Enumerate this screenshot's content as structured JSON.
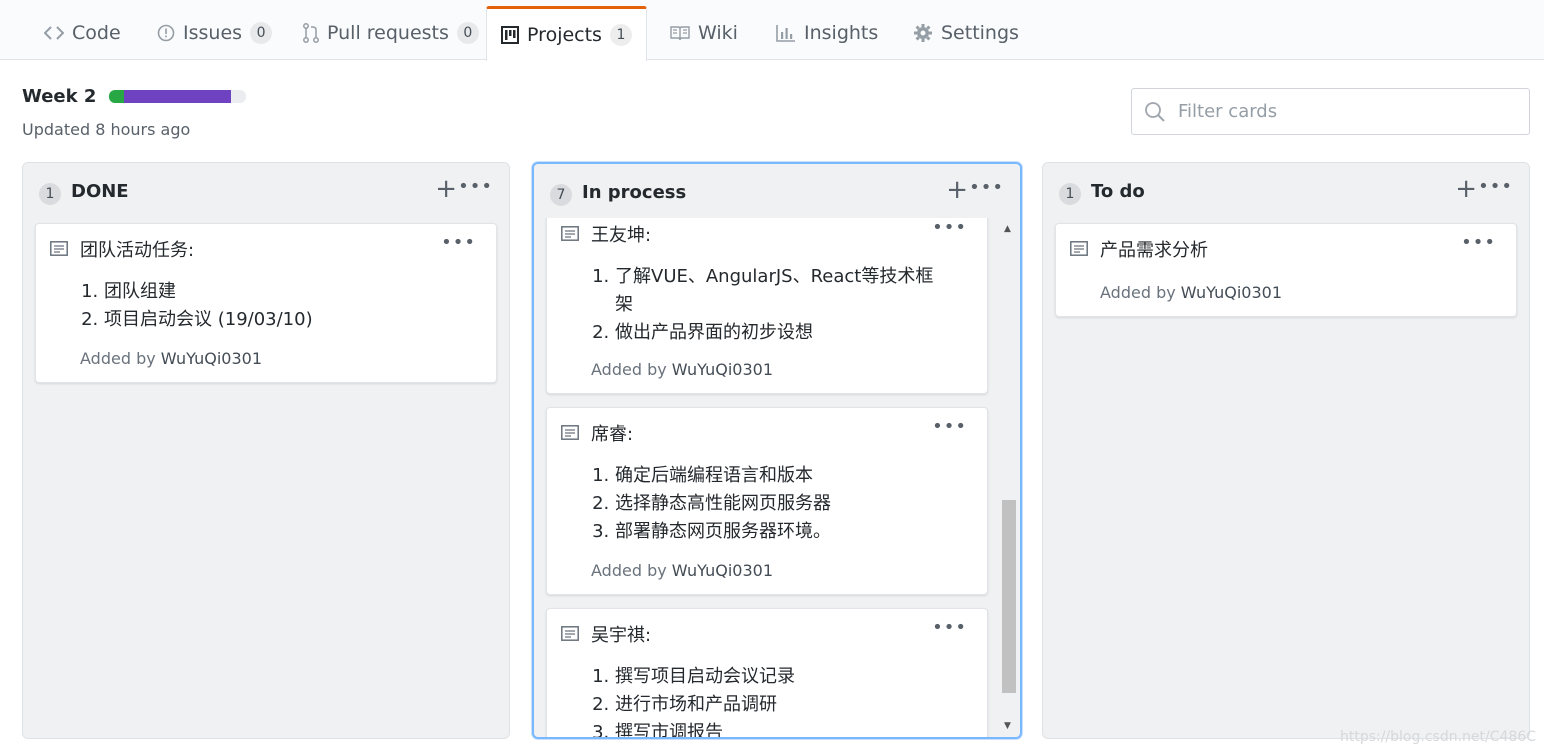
{
  "tabs": [
    {
      "label": "Code",
      "icon": "code-icon"
    },
    {
      "label": "Issues",
      "icon": "issue-icon",
      "count": "0"
    },
    {
      "label": "Pull requests",
      "icon": "pull-request-icon",
      "count": "0"
    },
    {
      "label": "Projects",
      "icon": "project-icon",
      "count": "1",
      "selected": true
    },
    {
      "label": "Wiki",
      "icon": "book-icon"
    },
    {
      "label": "Insights",
      "icon": "graph-icon"
    },
    {
      "label": "Settings",
      "icon": "gear-icon"
    }
  ],
  "project": {
    "name": "Week 2",
    "updated": "Updated 8 hours ago",
    "progress": {
      "done_fraction": 0.11,
      "in_progress_fraction": 0.78,
      "done_color": "#28a745",
      "in_progress_color": "#6f42c1"
    }
  },
  "filter": {
    "placeholder": "Filter cards"
  },
  "columns": [
    {
      "count": "1",
      "title": "DONE",
      "cards": [
        {
          "title": "团队活动任务:",
          "items": [
            "团队组建",
            "项目启动会议 (19/03/10)"
          ],
          "added_prefix": "Added by ",
          "author": "WuYuQi0301"
        }
      ]
    },
    {
      "count": "7",
      "title": "In process",
      "cards": [
        {
          "title": "王友坤:",
          "items": [
            "了解VUE、AngularJS、React等技术框架",
            "做出产品界面的初步设想"
          ],
          "added_prefix": "Added by ",
          "author": "WuYuQi0301"
        },
        {
          "title": "席睿:",
          "items": [
            "确定后端编程语言和版本",
            "选择静态高性能网页服务器",
            "部署静态网页服务器环境。"
          ],
          "added_prefix": "Added by ",
          "author": "WuYuQi0301"
        },
        {
          "title": "吴宇祺:",
          "items": [
            "撰写项目启动会议记录",
            "进行市场和产品调研",
            "撰写市调报告"
          ],
          "added_prefix": "",
          "author": ""
        }
      ]
    },
    {
      "count": "1",
      "title": "To do",
      "cards": [
        {
          "title": "产品需求分析",
          "items": [],
          "added_prefix": "Added by ",
          "author": "WuYuQi0301"
        }
      ]
    }
  ],
  "watermark": "https://blog.csdn.net/C486C"
}
